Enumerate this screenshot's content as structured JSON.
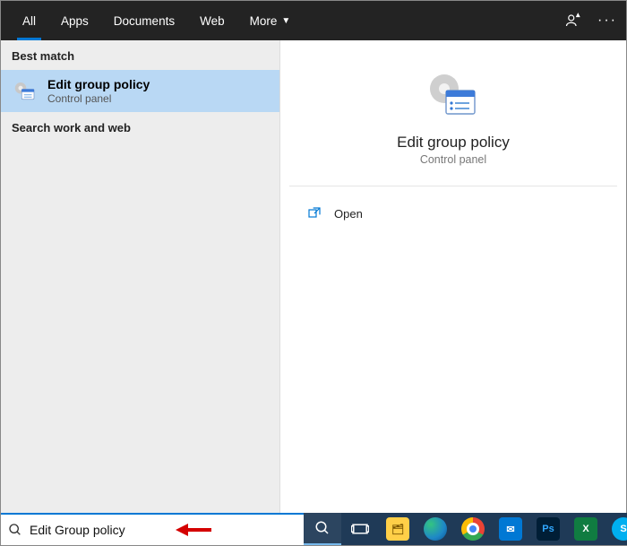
{
  "topbar": {
    "tabs": [
      {
        "label": "All",
        "active": true
      },
      {
        "label": "Apps",
        "active": false
      },
      {
        "label": "Documents",
        "active": false
      },
      {
        "label": "Web",
        "active": false
      },
      {
        "label": "More",
        "active": false,
        "dropdown": true
      }
    ]
  },
  "left": {
    "best_match_header": "Best match",
    "result": {
      "title": "Edit group policy",
      "sub": "Control panel"
    },
    "web_header": "Search work and web"
  },
  "preview": {
    "title": "Edit group policy",
    "sub": "Control panel"
  },
  "actions": {
    "open": "Open"
  },
  "search": {
    "value": "Edit Group policy"
  },
  "taskbar_apps": [
    {
      "name": "file-explorer",
      "glyph": "📁",
      "bg": "#ffcf48",
      "fg": "#000"
    },
    {
      "name": "edge",
      "glyph": "e",
      "bg": "#1e88c7",
      "round": true
    },
    {
      "name": "chrome",
      "glyph": "◑",
      "bg": "#ffffff",
      "fg": "#de5246",
      "round": true
    },
    {
      "name": "mail",
      "glyph": "✉",
      "bg": "#0078d4"
    },
    {
      "name": "photoshop",
      "glyph": "Ps",
      "bg": "#001e36",
      "fg": "#31a8ff"
    },
    {
      "name": "excel",
      "glyph": "X",
      "bg": "#107c41"
    },
    {
      "name": "skype",
      "glyph": "S",
      "bg": "#00aff0",
      "round": true
    }
  ]
}
